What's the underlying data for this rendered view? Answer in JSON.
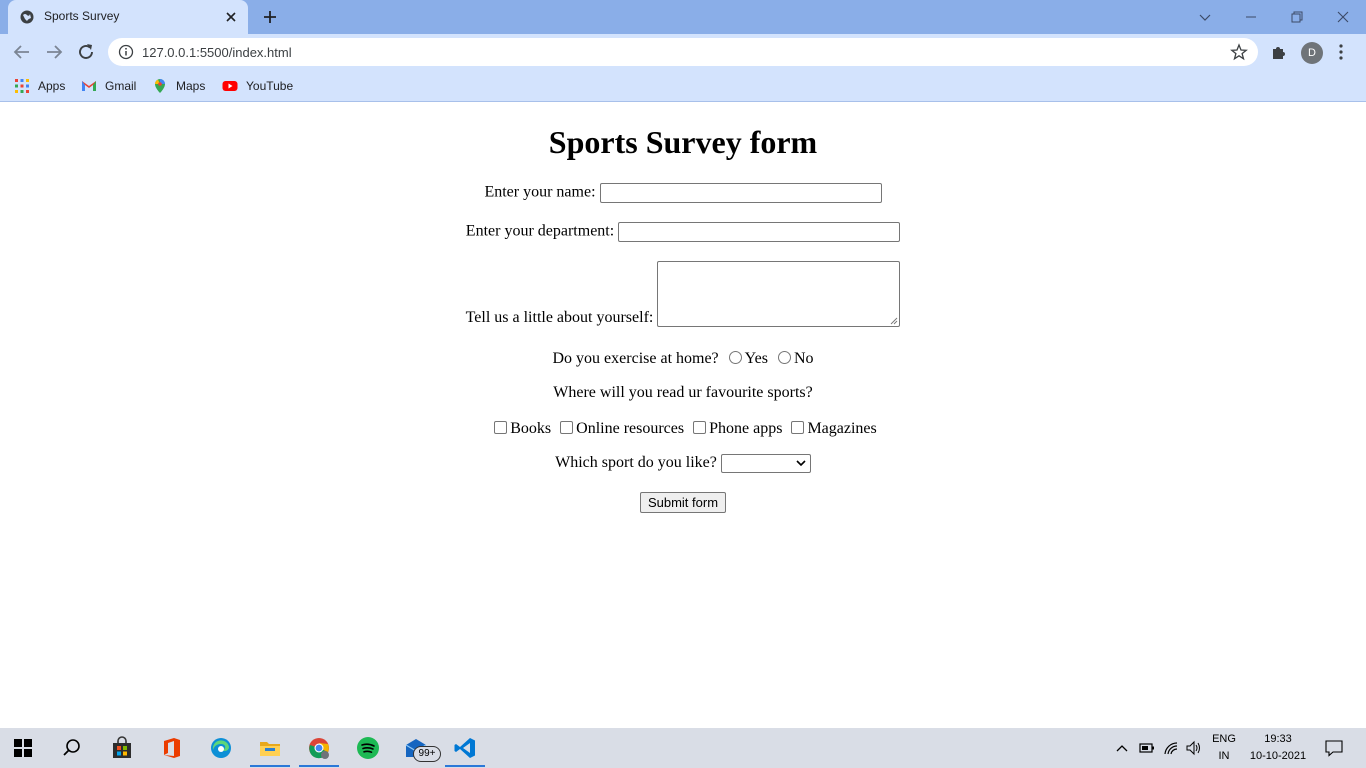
{
  "browser": {
    "tab_title": "Sports Survey",
    "url": "127.0.0.1:5500/index.html",
    "profile_initial": "D",
    "bookmarks": [
      "Apps",
      "Gmail",
      "Maps",
      "YouTube"
    ]
  },
  "form": {
    "heading": "Sports Survey form",
    "name_label": "Enter your name:",
    "name_value": "",
    "department_label": "Enter your department:",
    "department_value": "",
    "about_label": "Tell us a little about yourself:",
    "about_value": "",
    "exercise_question": "Do you exercise at home?",
    "exercise_options": [
      "Yes",
      "No"
    ],
    "read_question": "Where will you read ur favourite sports?",
    "read_options": [
      "Books",
      "Online resources",
      "Phone apps",
      "Magazines"
    ],
    "sport_question": "Which sport do you like?",
    "sport_selected": "",
    "submit_label": "Submit form"
  },
  "taskbar": {
    "mail_badge": "99+",
    "language_top": "ENG",
    "language_bottom": "IN",
    "time": "19:33",
    "date": "10-10-2021"
  },
  "colors": {
    "tab_strip": "#8aaee8",
    "toolbar": "#d3e3fd",
    "taskbar": "#d9dde6",
    "taskbar_active": "#2b78d8"
  },
  "icons": [
    "globe-icon",
    "close-icon",
    "plus-icon",
    "chevron-down-icon",
    "minimize-icon",
    "restore-icon",
    "back-icon",
    "forward-icon",
    "reload-icon",
    "info-icon",
    "star-icon",
    "puzzle-icon",
    "kebab-menu-icon",
    "apps-grid-icon",
    "gmail-icon",
    "maps-icon",
    "youtube-icon",
    "windows-start-icon",
    "search-icon",
    "store-icon",
    "office-icon",
    "edge-icon",
    "file-explorer-icon",
    "chrome-icon",
    "spotify-icon",
    "mail-icon",
    "vscode-icon",
    "chevron-up-icon",
    "battery-icon",
    "wifi-icon",
    "volume-icon",
    "notification-icon"
  ]
}
